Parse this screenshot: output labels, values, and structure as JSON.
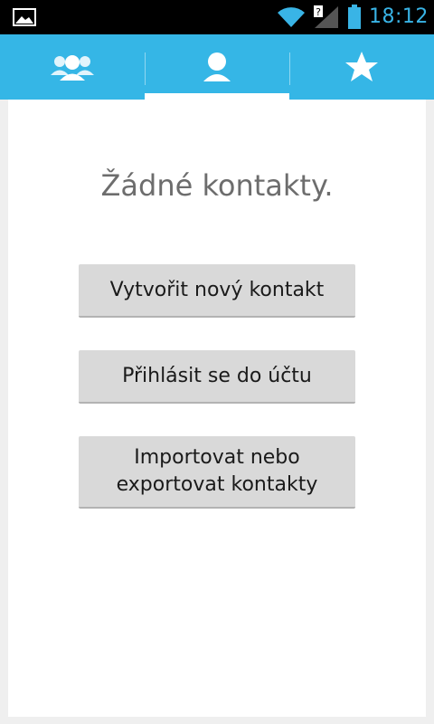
{
  "status_bar": {
    "time": "18:12",
    "icons": [
      "gallery-icon",
      "wifi-icon",
      "signal-icon",
      "battery-icon"
    ]
  },
  "tabs": [
    {
      "icon": "group-icon",
      "selected": false
    },
    {
      "icon": "person-icon",
      "selected": true
    },
    {
      "icon": "star-icon",
      "selected": false
    }
  ],
  "colors": {
    "accent": "#35b6e6",
    "status_blue": "#39b4e6",
    "button_bg": "#d9d9d9",
    "empty_text": "#6d6d6d"
  },
  "main": {
    "empty_message": "Žádné kontakty.",
    "buttons": {
      "create": "Vytvořit nový kontakt",
      "login": "Přihlásit se do účtu",
      "import_line1": "Importovat nebo",
      "import_line2": "exportovat kontakty"
    }
  }
}
